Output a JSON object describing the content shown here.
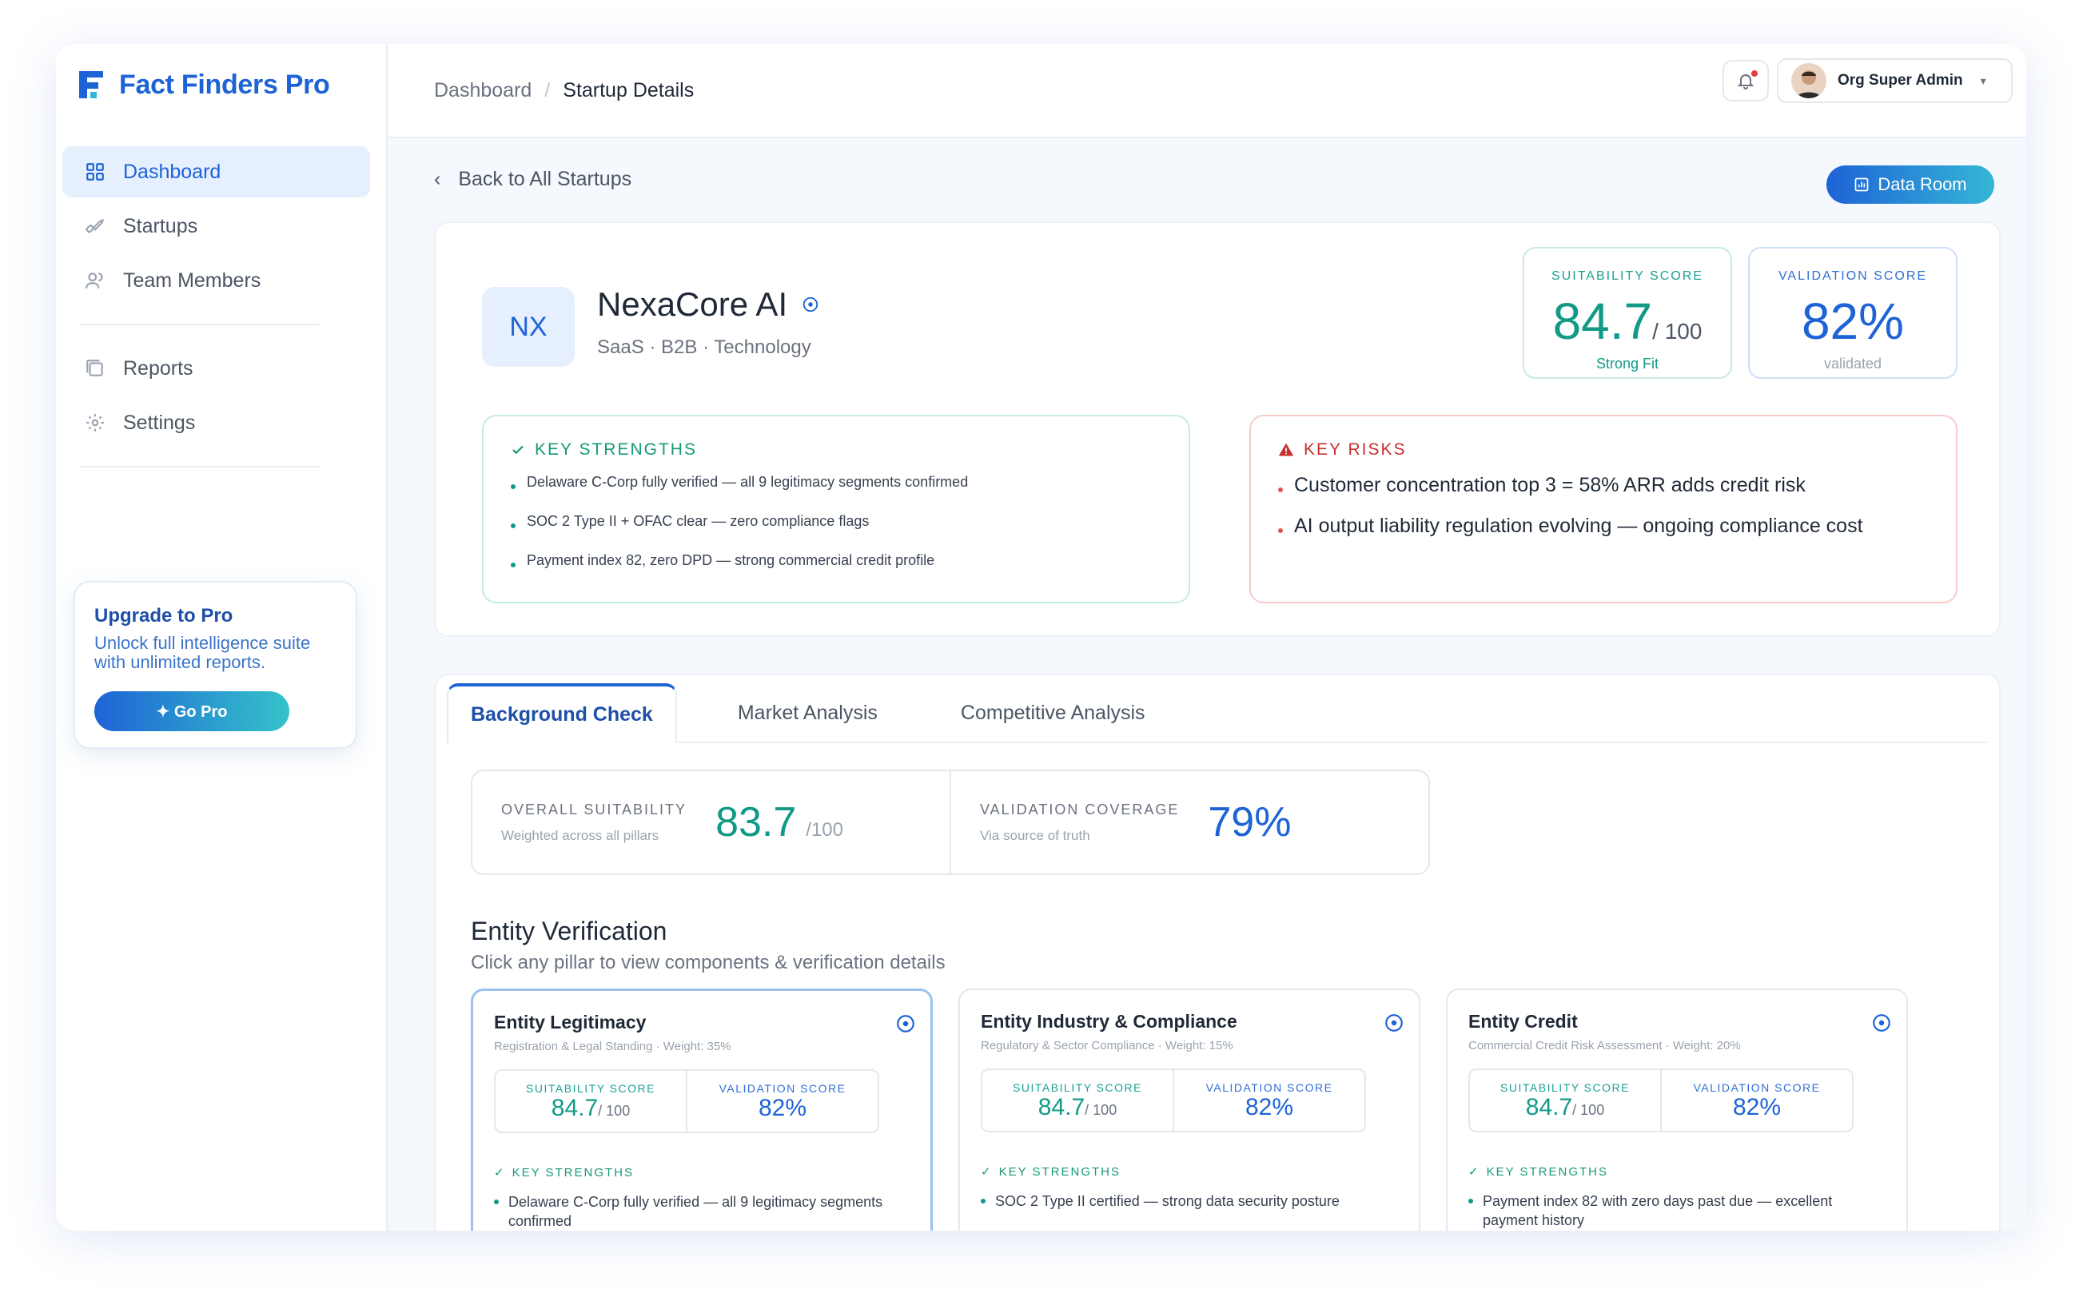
{
  "brand": {
    "name": "Fact Finders Pro"
  },
  "sidebar": {
    "items": [
      {
        "label": "Dashboard",
        "icon": "grid-icon",
        "active": true
      },
      {
        "label": "Startups",
        "icon": "rocket-icon"
      },
      {
        "label": "Team Members",
        "icon": "users-icon"
      },
      {
        "label": "Reports",
        "icon": "reports-icon"
      },
      {
        "label": "Settings",
        "icon": "gear-icon"
      }
    ],
    "upgrade": {
      "title": "Upgrade to Pro",
      "desc": "Unlock full intelligence suite with unlimited reports.",
      "button": "✦ Go Pro"
    }
  },
  "header": {
    "breadcrumb": [
      "Dashboard",
      "/",
      "Startup Details"
    ],
    "user": "Org Super Admin"
  },
  "back_label": "Back to All Startups",
  "data_room_label": "Data Room",
  "company": {
    "initials": "NX",
    "name": "NexaCore AI",
    "tags": "SaaS · B2B · Technology"
  },
  "scores": {
    "suitability": {
      "label": "SUITABILITY SCORE",
      "value": "84.7",
      "max": "/ 100",
      "sub": "Strong Fit"
    },
    "validation": {
      "label": "VALIDATION SCORE",
      "value": "82%",
      "sub": "validated"
    }
  },
  "strengths": {
    "title": "KEY STRENGTHS",
    "items": [
      "Delaware C-Corp fully verified — all 9 legitimacy segments confirmed",
      "SOC 2 Type II + OFAC clear — zero compliance flags",
      "Payment index 82, zero DPD — strong commercial credit profile"
    ]
  },
  "risks": {
    "title": "KEY RISKS",
    "items": [
      "Customer concentration top 3 = 58% ARR adds credit risk",
      "AI output liability regulation evolving — ongoing compliance cost"
    ]
  },
  "tabs": [
    "Background Check",
    "Market Analysis",
    "Competitive Analysis"
  ],
  "metrics": {
    "overall": {
      "label": "OVERALL SUITABILITY",
      "sub": "Weighted across all pillars",
      "value": "83.7",
      "max": "/100"
    },
    "coverage": {
      "label": "VALIDATION COVERAGE",
      "sub": "Via source of truth",
      "value": "79%"
    }
  },
  "entity": {
    "title": "Entity Verification",
    "subtitle": "Click any pillar to view components & verification details",
    "pillars": [
      {
        "name": "Entity Legitimacy",
        "meta": "Registration & Legal Standing · Weight: 35%",
        "suit_label": "SUITABILITY SCORE",
        "suit_value": "84.7",
        "suit_max": "/ 100",
        "val_label": "VALIDATION SCORE",
        "val_value": "82%",
        "ks_label": "KEY STRENGTHS",
        "ks_item": "Delaware C-Corp fully verified — all 9 legitimacy segments confirmed"
      },
      {
        "name": "Entity Industry & Compliance",
        "meta": "Regulatory & Sector Compliance · Weight: 15%",
        "suit_label": "SUITABILITY SCORE",
        "suit_value": "84.7",
        "suit_max": "/ 100",
        "val_label": "VALIDATION SCORE",
        "val_value": "82%",
        "ks_label": "KEY STRENGTHS",
        "ks_item": "SOC 2 Type II certified — strong data security posture"
      },
      {
        "name": "Entity Credit",
        "meta": "Commercial Credit Risk Assessment · Weight: 20%",
        "suit_label": "SUITABILITY SCORE",
        "suit_value": "84.7",
        "suit_max": "/ 100",
        "val_label": "VALIDATION SCORE",
        "val_value": "82%",
        "ks_label": "KEY STRENGTHS",
        "ks_item": "Payment index 82 with zero days past due — excellent payment history"
      }
    ]
  },
  "colors": {
    "primary": "#1e63d6",
    "teal": "#129a86",
    "risk": "#c53030"
  }
}
